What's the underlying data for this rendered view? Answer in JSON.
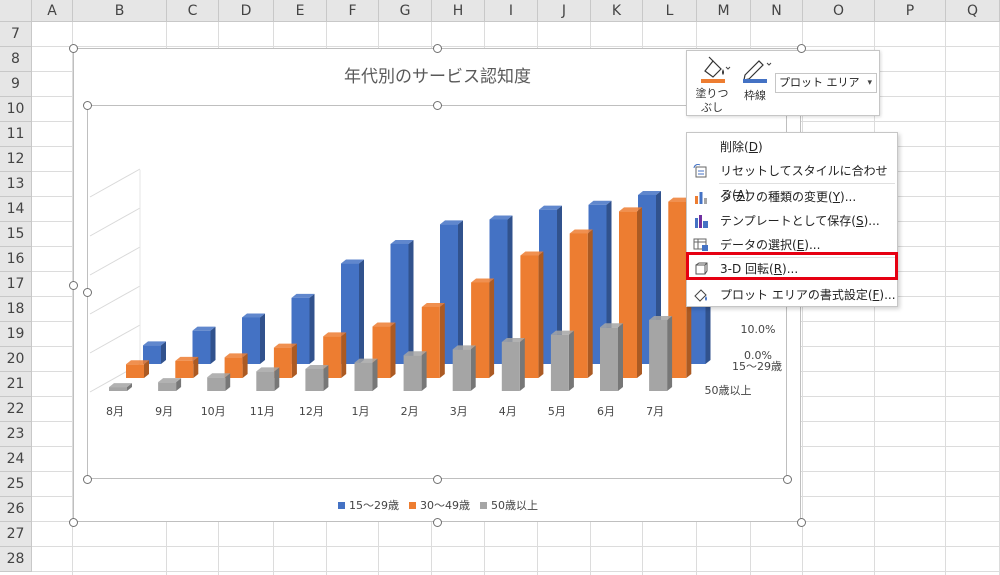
{
  "sheet": {
    "columns": [
      "A",
      "B",
      "C",
      "D",
      "E",
      "F",
      "G",
      "H",
      "I",
      "J",
      "K",
      "L",
      "M",
      "N",
      "O",
      "P",
      "Q"
    ],
    "rows": [
      "7",
      "8",
      "9",
      "10",
      "11",
      "12",
      "13",
      "14",
      "15",
      "16",
      "17",
      "18",
      "19",
      "20",
      "21",
      "22",
      "23",
      "24",
      "25",
      "26",
      "27",
      "28"
    ]
  },
  "chart": {
    "title": "年代別のサービス認知度",
    "depth_axis_labels": [
      "15～29歳",
      "50歳以上"
    ],
    "legend": [
      "15～29歳",
      "30～49歳",
      "50歳以上"
    ]
  },
  "chart_data": {
    "type": "bar",
    "title": "年代別のサービス認知度",
    "categories": [
      "8月",
      "9月",
      "10月",
      "11月",
      "12月",
      "1月",
      "2月",
      "3月",
      "4月",
      "5月",
      "6月",
      "7月"
    ],
    "series": [
      {
        "name": "15～29歳",
        "color": "#4472c4",
        "values": [
          3.8,
          6.8,
          9.5,
          13.5,
          20.5,
          24.5,
          28.5,
          29.5,
          31.5,
          32.5,
          34.5,
          36.5
        ]
      },
      {
        "name": "30～49歳",
        "color": "#ed7d31",
        "values": [
          2.8,
          3.5,
          4.2,
          6.2,
          8.5,
          10.5,
          14.5,
          19.5,
          25.0,
          29.5,
          34.0,
          36.0
        ]
      },
      {
        "name": "50歳以上",
        "color": "#a5a5a5",
        "values": [
          0.8,
          1.8,
          2.8,
          4.0,
          4.5,
          5.8,
          7.3,
          8.5,
          10.0,
          11.5,
          13.0,
          14.5
        ]
      }
    ],
    "ytick_labels": [
      "0.0%",
      "10.0%"
    ],
    "ylim": [
      0,
      40
    ],
    "legend_position": "bottom",
    "three_d": true
  },
  "toolbar": {
    "fill_label_1": "塗りつ",
    "fill_label_2": "ぶし",
    "outline_label": "枠線",
    "element_select_value": "プロット エリア"
  },
  "context_menu": {
    "items": [
      {
        "label": "削除(",
        "key": "D",
        "tail": ")"
      },
      {
        "label": "リセットしてスタイルに合わせる(",
        "key": "A",
        "tail": ")"
      },
      {
        "label": "グラフの種類の変更(",
        "key": "Y",
        "tail": ")..."
      },
      {
        "label": "テンプレートとして保存(",
        "key": "S",
        "tail": ")..."
      },
      {
        "label": "データの選択(",
        "key": "E",
        "tail": ")..."
      },
      {
        "label": "3-D 回転(",
        "key": "R",
        "tail": ")..."
      },
      {
        "label": "プロット エリアの書式設定(",
        "key": "F",
        "tail": ")..."
      }
    ]
  },
  "colors": {
    "highlight": "#e60012",
    "blue": "#4472c4",
    "orange": "#ed7d31",
    "gray": "#a5a5a5"
  }
}
